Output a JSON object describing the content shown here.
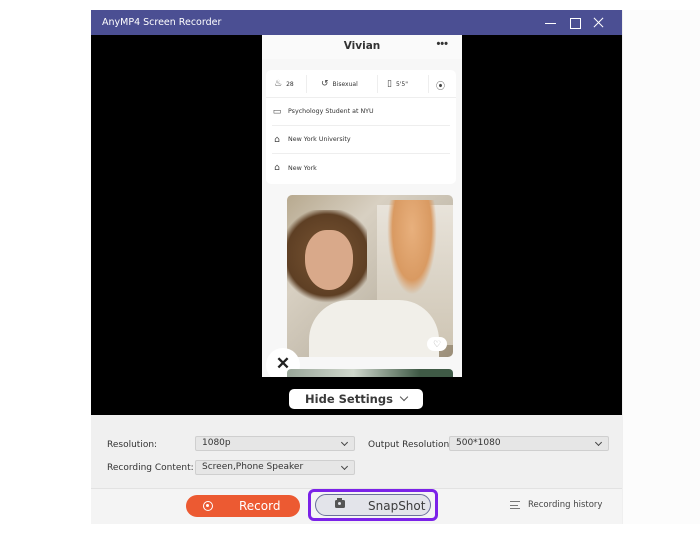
{
  "window": {
    "title": "AnyMP4 Screen Recorder",
    "controls": [
      "minimize",
      "maximize",
      "close"
    ],
    "titlebar_color": "#4b4f93"
  },
  "phone_screen": {
    "profile_name": "Vivian",
    "more_icon": "more-horizontal-icon",
    "stats": [
      {
        "icon": "age-cake-icon",
        "value": "28"
      },
      {
        "icon": "orientation-icon",
        "value": "Bisexual"
      },
      {
        "icon": "height-ruler-icon",
        "value": "5'5\""
      },
      {
        "icon": "location-pin-icon",
        "value": ""
      }
    ],
    "details": [
      {
        "icon": "briefcase-icon",
        "text": "Psychology Student at NYU"
      },
      {
        "icon": "graduation-cap-icon",
        "text": "New York University"
      },
      {
        "icon": "home-icon",
        "text": "New York"
      }
    ],
    "photo_like_icon": "heart-icon",
    "dismiss_icon": "close-x-icon"
  },
  "hide_settings": {
    "label": "Hide Settings"
  },
  "settings": {
    "resolution_label": "Resolution:",
    "resolution_value": "1080p",
    "output_resolution_label": "Output Resolution:",
    "output_resolution_value": "500*1080",
    "recording_content_label": "Recording Content:",
    "recording_content_value": "Screen,Phone Speaker"
  },
  "actions": {
    "record_label": "Record",
    "snapshot_label": "SnapShot",
    "history_label": "Recording history",
    "record_color": "#ec5a32",
    "highlight_color": "#7b22e8"
  }
}
